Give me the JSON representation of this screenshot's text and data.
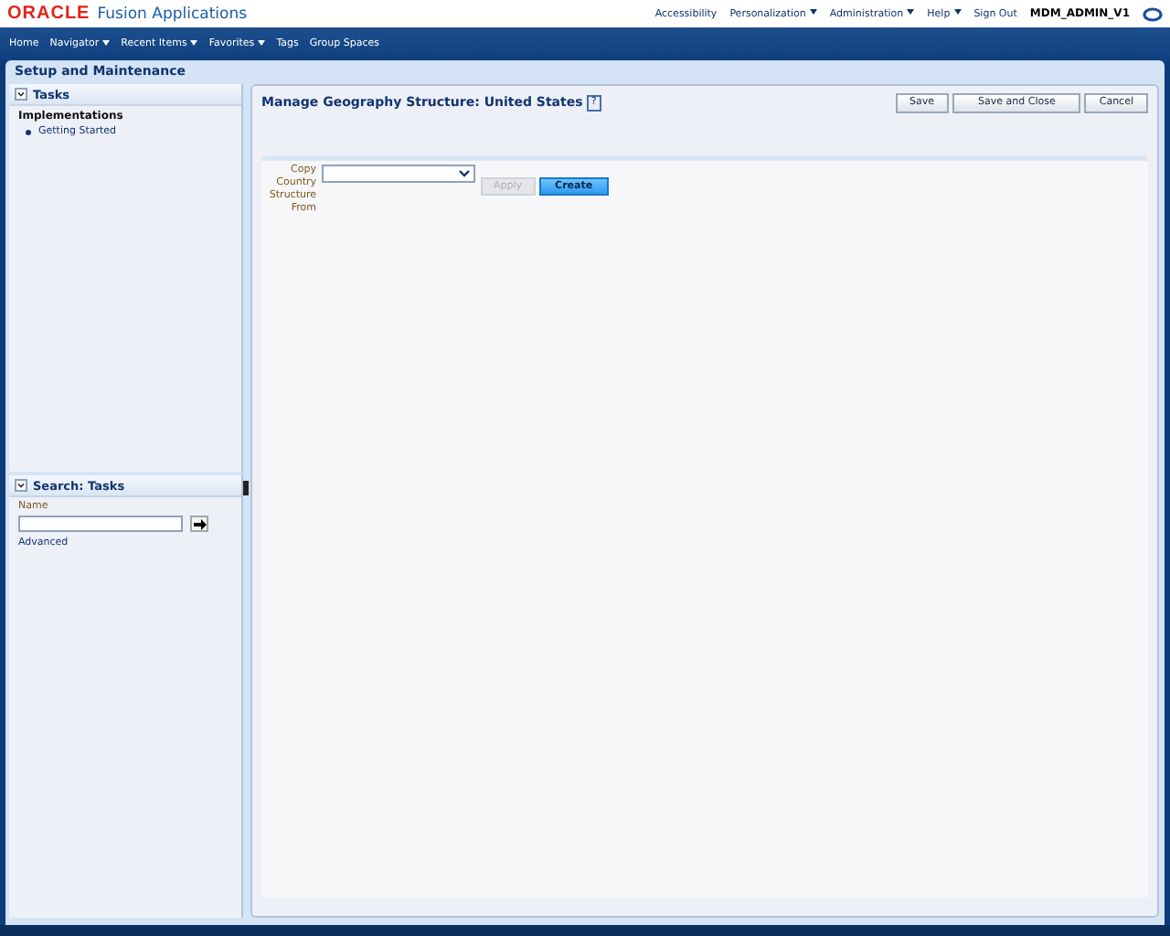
{
  "brand": {
    "logo": "ORACLE",
    "product": "Fusion Applications"
  },
  "global_links": [
    {
      "label": "Accessibility",
      "menu": false
    },
    {
      "label": "Personalization",
      "menu": true
    },
    {
      "label": "Administration",
      "menu": true
    },
    {
      "label": "Help",
      "menu": true
    },
    {
      "label": "Sign Out",
      "menu": false
    }
  ],
  "user": "MDM_ADMIN_V1",
  "nav": [
    {
      "label": "Home",
      "menu": false
    },
    {
      "label": "Navigator",
      "menu": true
    },
    {
      "label": "Recent Items",
      "menu": true
    },
    {
      "label": "Favorites",
      "menu": true
    },
    {
      "label": "Tags",
      "menu": false
    },
    {
      "label": "Group Spaces",
      "menu": false
    }
  ],
  "page_title": "Setup and Maintenance",
  "tasks": {
    "title": "Tasks",
    "expanded": true,
    "group": "Implementations",
    "items": [
      "Getting Started"
    ]
  },
  "search": {
    "title": "Search: Tasks",
    "expanded": true,
    "field_label": "Name",
    "link": "Advanced"
  },
  "main": {
    "title": "Manage Geography Structure: United States",
    "help": "?",
    "buttons": [
      "Save",
      "Save and Close",
      "Cancel"
    ],
    "copy_label": [
      "Copy",
      "Country",
      "Structure",
      "From"
    ],
    "actions": [
      {
        "label": "Apply",
        "disabled": true,
        "primary": false
      },
      {
        "label": "Create",
        "disabled": false,
        "primary": true
      }
    ]
  }
}
